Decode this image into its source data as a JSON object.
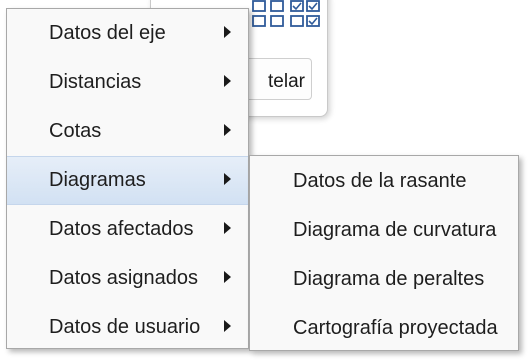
{
  "background_dialog": {
    "button_label": "telar",
    "icons": [
      "grid-outline-icon",
      "grid-check-icon"
    ]
  },
  "context_menu": {
    "items": [
      {
        "label": "Datos del eje",
        "has_submenu": true,
        "highlighted": false
      },
      {
        "label": "Distancias",
        "has_submenu": true,
        "highlighted": false
      },
      {
        "label": "Cotas",
        "has_submenu": true,
        "highlighted": false
      },
      {
        "label": "Diagramas",
        "has_submenu": true,
        "highlighted": true
      },
      {
        "label": "Datos afectados",
        "has_submenu": true,
        "highlighted": false
      },
      {
        "label": "Datos asignados",
        "has_submenu": true,
        "highlighted": false
      },
      {
        "label": "Datos de usuario",
        "has_submenu": true,
        "highlighted": false
      }
    ]
  },
  "submenu": {
    "items": [
      {
        "label": "Datos de la rasante"
      },
      {
        "label": "Diagrama de curvatura"
      },
      {
        "label": "Diagrama de peraltes"
      },
      {
        "label": "Cartografía proyectada"
      }
    ]
  },
  "colors": {
    "menu_background": "#f9f9f9",
    "highlight_top": "#e6eef8",
    "highlight_bottom": "#d2e1f3",
    "menu_border": "#a8a8a8",
    "icon_blue": "#2f5b9a"
  }
}
